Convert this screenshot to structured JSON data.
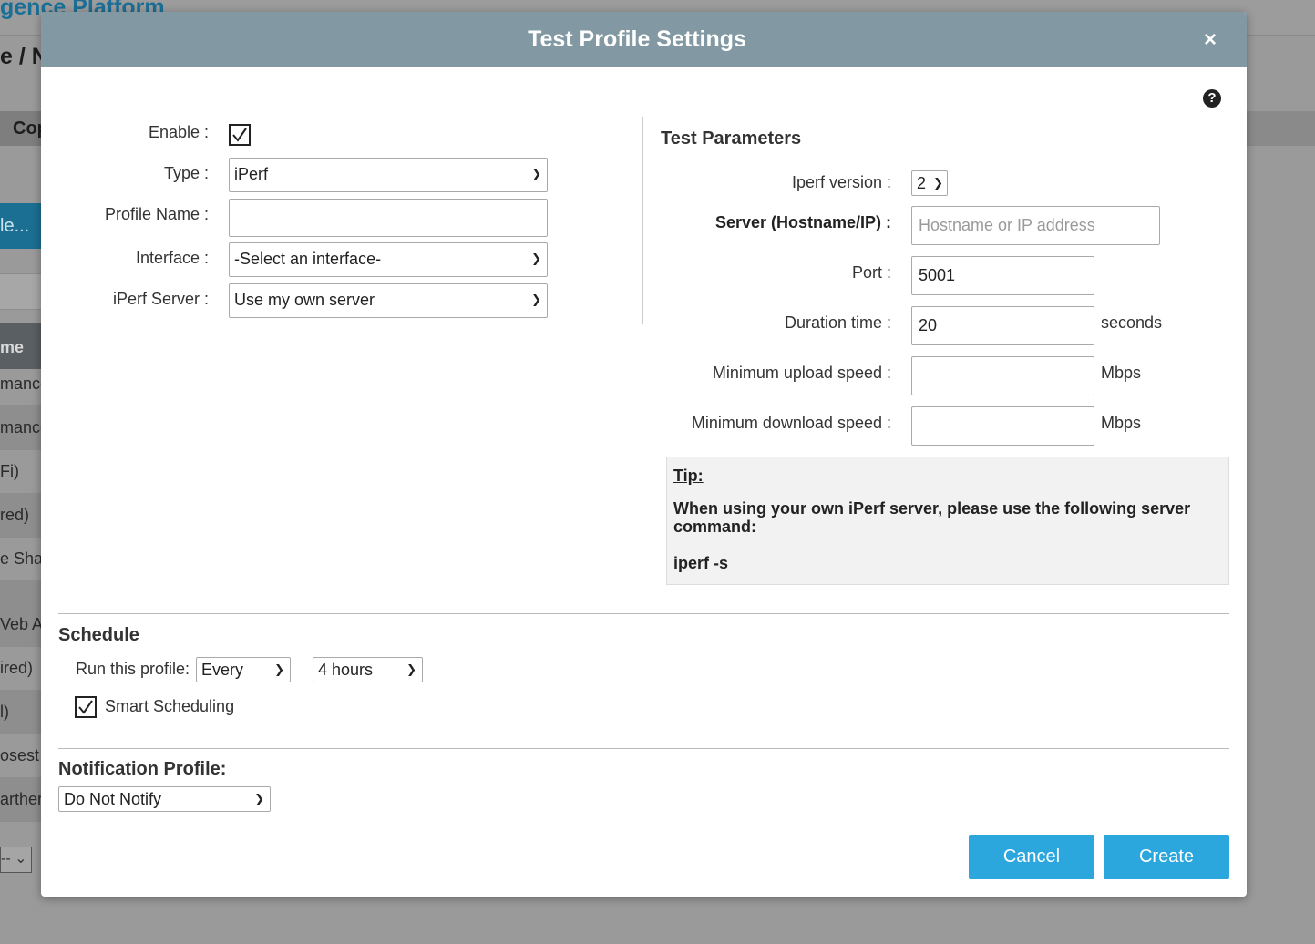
{
  "background": {
    "brand": "gence Platform",
    "breadcrumb": "e / N",
    "tab": "Cop",
    "button": "le...",
    "table_header": "me",
    "rows": [
      "mance",
      "mance",
      "Fi)",
      "red)",
      "e Shar",
      "",
      "Veb Ap",
      "ired)",
      "l)",
      "osest",
      "arther"
    ],
    "select": "-- "
  },
  "modal": {
    "title": "Test Profile Settings",
    "close_label": "×",
    "help_glyph": "?"
  },
  "left_form": {
    "enable_label": "Enable :",
    "enable_checked": true,
    "type_label": "Type :",
    "type_value": "iPerf",
    "profile_name_label": "Profile Name :",
    "profile_name_value": "",
    "interface_label": "Interface :",
    "interface_value": "-Select an interface-",
    "server_label": "iPerf Server :",
    "server_value": "Use my own server"
  },
  "test_parameters": {
    "heading": "Test Parameters",
    "iperf_version_label": "Iperf version :",
    "iperf_version_value": "2",
    "server_label": "Server (Hostname/IP) :",
    "server_placeholder": "Hostname or IP address",
    "port_label": "Port :",
    "port_value": "5001",
    "duration_label": "Duration time :",
    "duration_value": "20",
    "duration_unit": "seconds",
    "min_upload_label": "Minimum upload speed :",
    "min_upload_value": "",
    "min_upload_unit": "Mbps",
    "min_download_label": "Minimum download speed :",
    "min_download_value": "",
    "min_download_unit": "Mbps"
  },
  "tip": {
    "title": "Tip:",
    "text": "When using your own iPerf server, please use the following server command:",
    "command": "iperf -s"
  },
  "schedule": {
    "heading": "Schedule",
    "run_label": "Run this profile:",
    "frequency": "Every",
    "interval": "4 hours",
    "smart_label": "Smart Scheduling",
    "smart_checked": true
  },
  "notification": {
    "heading": "Notification Profile:",
    "value": "Do Not Notify"
  },
  "footer": {
    "cancel_label": "Cancel",
    "create_label": "Create"
  },
  "colors": {
    "header": "#8299a3",
    "button": "#2ba7de",
    "tip_bg": "#f2f2f2"
  }
}
